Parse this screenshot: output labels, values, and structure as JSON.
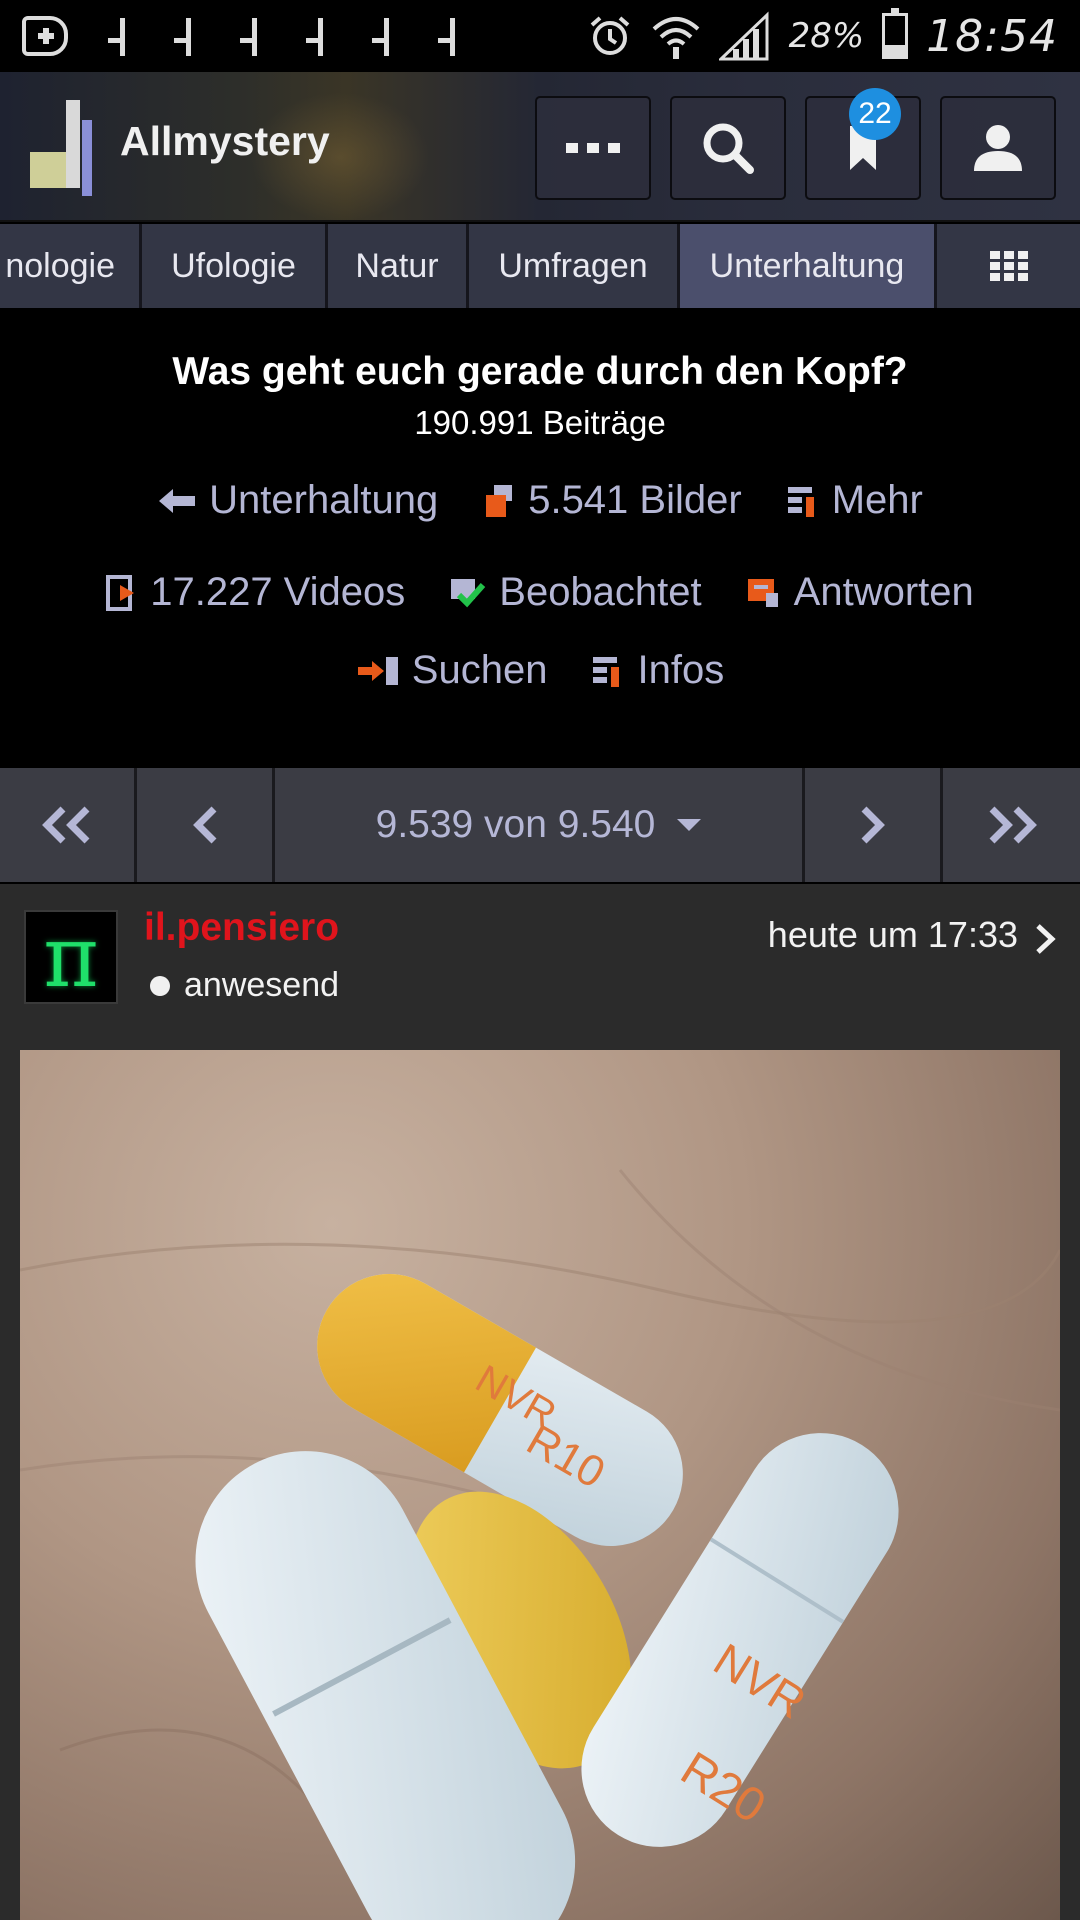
{
  "status_bar": {
    "battery_percent": "28%",
    "battery_level": 0.28,
    "time": "18:54",
    "notification_icons": [
      "add-box-icon",
      "music-note-icon",
      "music-note-icon",
      "music-note-icon",
      "music-note-icon",
      "music-note-icon",
      "music-note-icon"
    ]
  },
  "header": {
    "brand": "Allmystery",
    "bookmark_badge": "22",
    "buttons": [
      "more-icon",
      "search-icon",
      "bookmark-icon",
      "user-icon"
    ]
  },
  "tabs": [
    {
      "label": "nologie",
      "active": false
    },
    {
      "label": "Ufologie",
      "active": false
    },
    {
      "label": "Natur",
      "active": false
    },
    {
      "label": "Umfragen",
      "active": false
    },
    {
      "label": "Unterhaltung",
      "active": true
    }
  ],
  "thread": {
    "title": "Was geht euch gerade durch den Kopf?",
    "post_count": "190.991 Beiträge",
    "links": {
      "back": "Unterhaltung",
      "images": "5.541 Bilder",
      "more": "Mehr",
      "videos": "17.227 Videos",
      "watched": "Beobachtet",
      "reply": "Antworten",
      "search": "Suchen",
      "info": "Infos"
    }
  },
  "pager": {
    "current": "9.539 von 9.540"
  },
  "post": {
    "avatar_glyph": "π",
    "username": "il.pensiero",
    "status": "anwesend",
    "time": "heute um 17:33",
    "pill_labels": [
      "NVR",
      "R10",
      "NVR",
      "R20"
    ]
  },
  "colors": {
    "accent": "#4b4f6c",
    "link": "#b4b6d4",
    "username": "#e0141c",
    "badge": "#1e8fe0"
  }
}
